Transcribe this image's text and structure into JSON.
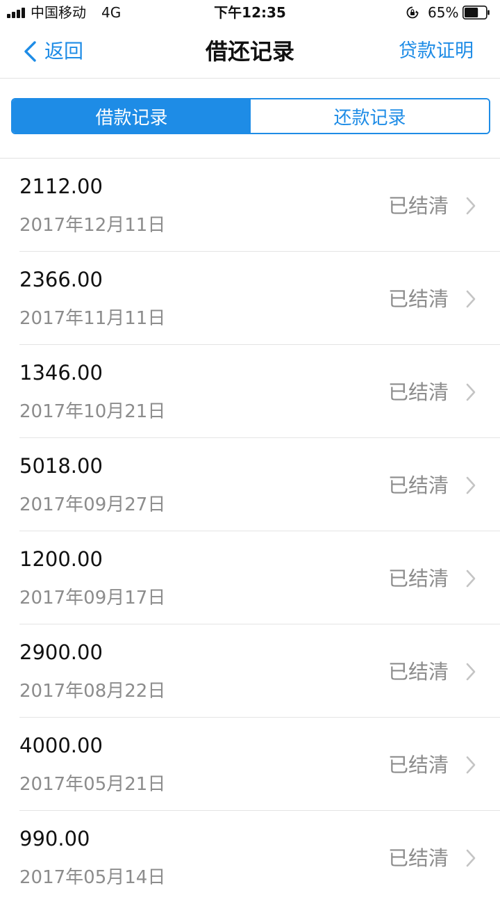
{
  "status_bar": {
    "carrier": "中国移动",
    "network": "4G",
    "time": "下午12:35",
    "battery": "65%",
    "battery_level": 0.65
  },
  "nav": {
    "back_label": "返回",
    "title": "借还记录",
    "right_action": "贷款证明"
  },
  "tabs": [
    {
      "label": "借款记录",
      "active": true
    },
    {
      "label": "还款记录",
      "active": false
    }
  ],
  "records": [
    {
      "amount": "2112.00",
      "date": "2017年12月11日",
      "status": "已结清"
    },
    {
      "amount": "2366.00",
      "date": "2017年11月11日",
      "status": "已结清"
    },
    {
      "amount": "1346.00",
      "date": "2017年10月21日",
      "status": "已结清"
    },
    {
      "amount": "5018.00",
      "date": "2017年09月27日",
      "status": "已结清"
    },
    {
      "amount": "1200.00",
      "date": "2017年09月17日",
      "status": "已结清"
    },
    {
      "amount": "2900.00",
      "date": "2017年08月22日",
      "status": "已结清"
    },
    {
      "amount": "4000.00",
      "date": "2017年05月21日",
      "status": "已结清"
    },
    {
      "amount": "990.00",
      "date": "2017年05月14日",
      "status": "已结清"
    }
  ],
  "colors": {
    "accent": "#1e8ce6",
    "secondary_text": "#8c8c8c",
    "divider": "#e4e4e4"
  },
  "icons": {
    "signal": "signal-bars-icon",
    "lock": "orientation-lock-icon",
    "battery": "battery-icon",
    "back": "chevron-left-icon",
    "row": "chevron-right-icon"
  }
}
